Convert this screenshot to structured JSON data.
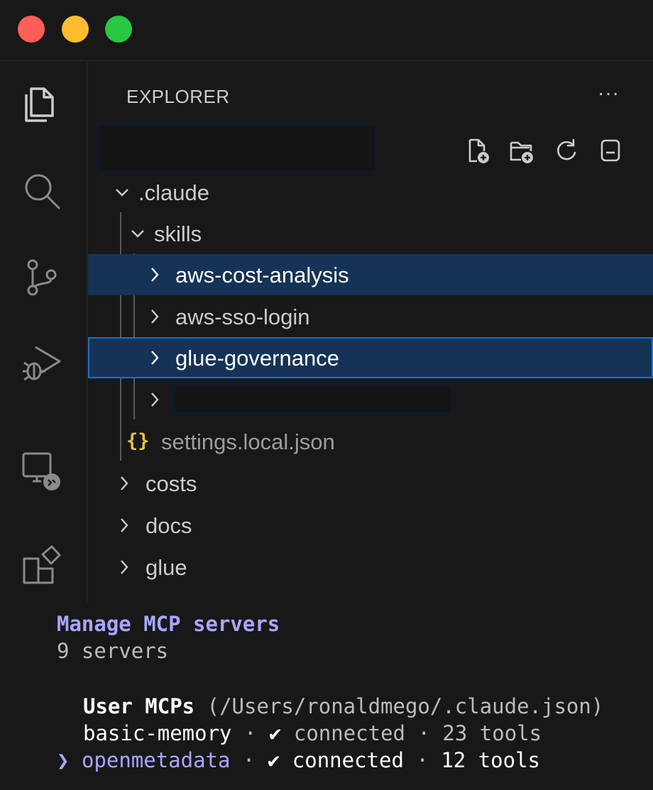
{
  "explorer": {
    "title": "EXPLORER",
    "more": "···"
  },
  "tree": {
    "claude_folder": ".claude",
    "skills_folder": "skills",
    "skill_items": [
      "aws-cost-analysis",
      "aws-sso-login",
      "glue-governance"
    ],
    "json_icon": "{}",
    "settings_file": "settings.local.json",
    "root_folders": [
      "costs",
      "docs",
      "glue"
    ]
  },
  "activity_icons": [
    "files-icon",
    "search-icon",
    "source-control-icon",
    "run-debug-icon",
    "remote-explorer-icon",
    "extensions-icon"
  ],
  "toolbar_icons": [
    "new-file-icon",
    "new-folder-icon",
    "refresh-icon",
    "collapse-all-icon"
  ],
  "terminal": {
    "heading": "Manage MCP servers",
    "count": "9 servers",
    "section_label": "User MCPs",
    "section_path": "(/Users/ronaldmego/.claude.json)",
    "servers": [
      {
        "name": "basic-memory",
        "status": "connected",
        "tools": "23 tools"
      },
      {
        "name": "openmetadata",
        "status": "connected",
        "tools": "12 tools"
      }
    ],
    "separator": "·",
    "check": "✔",
    "cursor": "❯"
  }
}
